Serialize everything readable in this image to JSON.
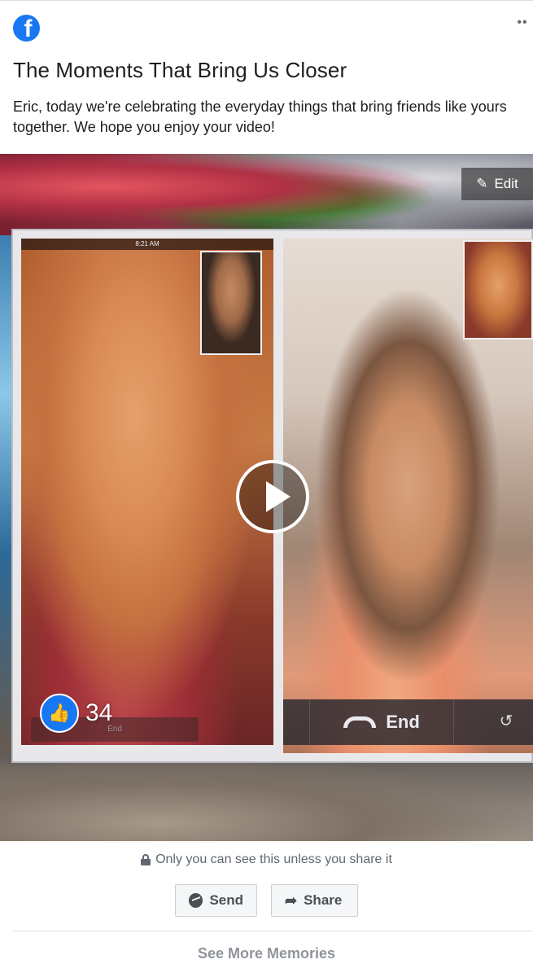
{
  "header": {
    "logo_letter": "f",
    "more_label": "••"
  },
  "post": {
    "title": "The Moments That Bring Us Closer",
    "message": "Eric, today we're celebrating the everyday things that bring friends like yours together. We hope you enjoy your video!"
  },
  "video": {
    "edit_label": "Edit",
    "status_time": "8:21 AM",
    "end_label": "End",
    "small_end_label": "End",
    "like_count": "34"
  },
  "footer": {
    "privacy_text": "Only you can see this unless you share it",
    "send_label": "Send",
    "share_label": "Share",
    "see_more_label": "See More Memories"
  },
  "colors": {
    "brand": "#1877f2",
    "text": "#1c1e21",
    "muted": "#606770"
  }
}
